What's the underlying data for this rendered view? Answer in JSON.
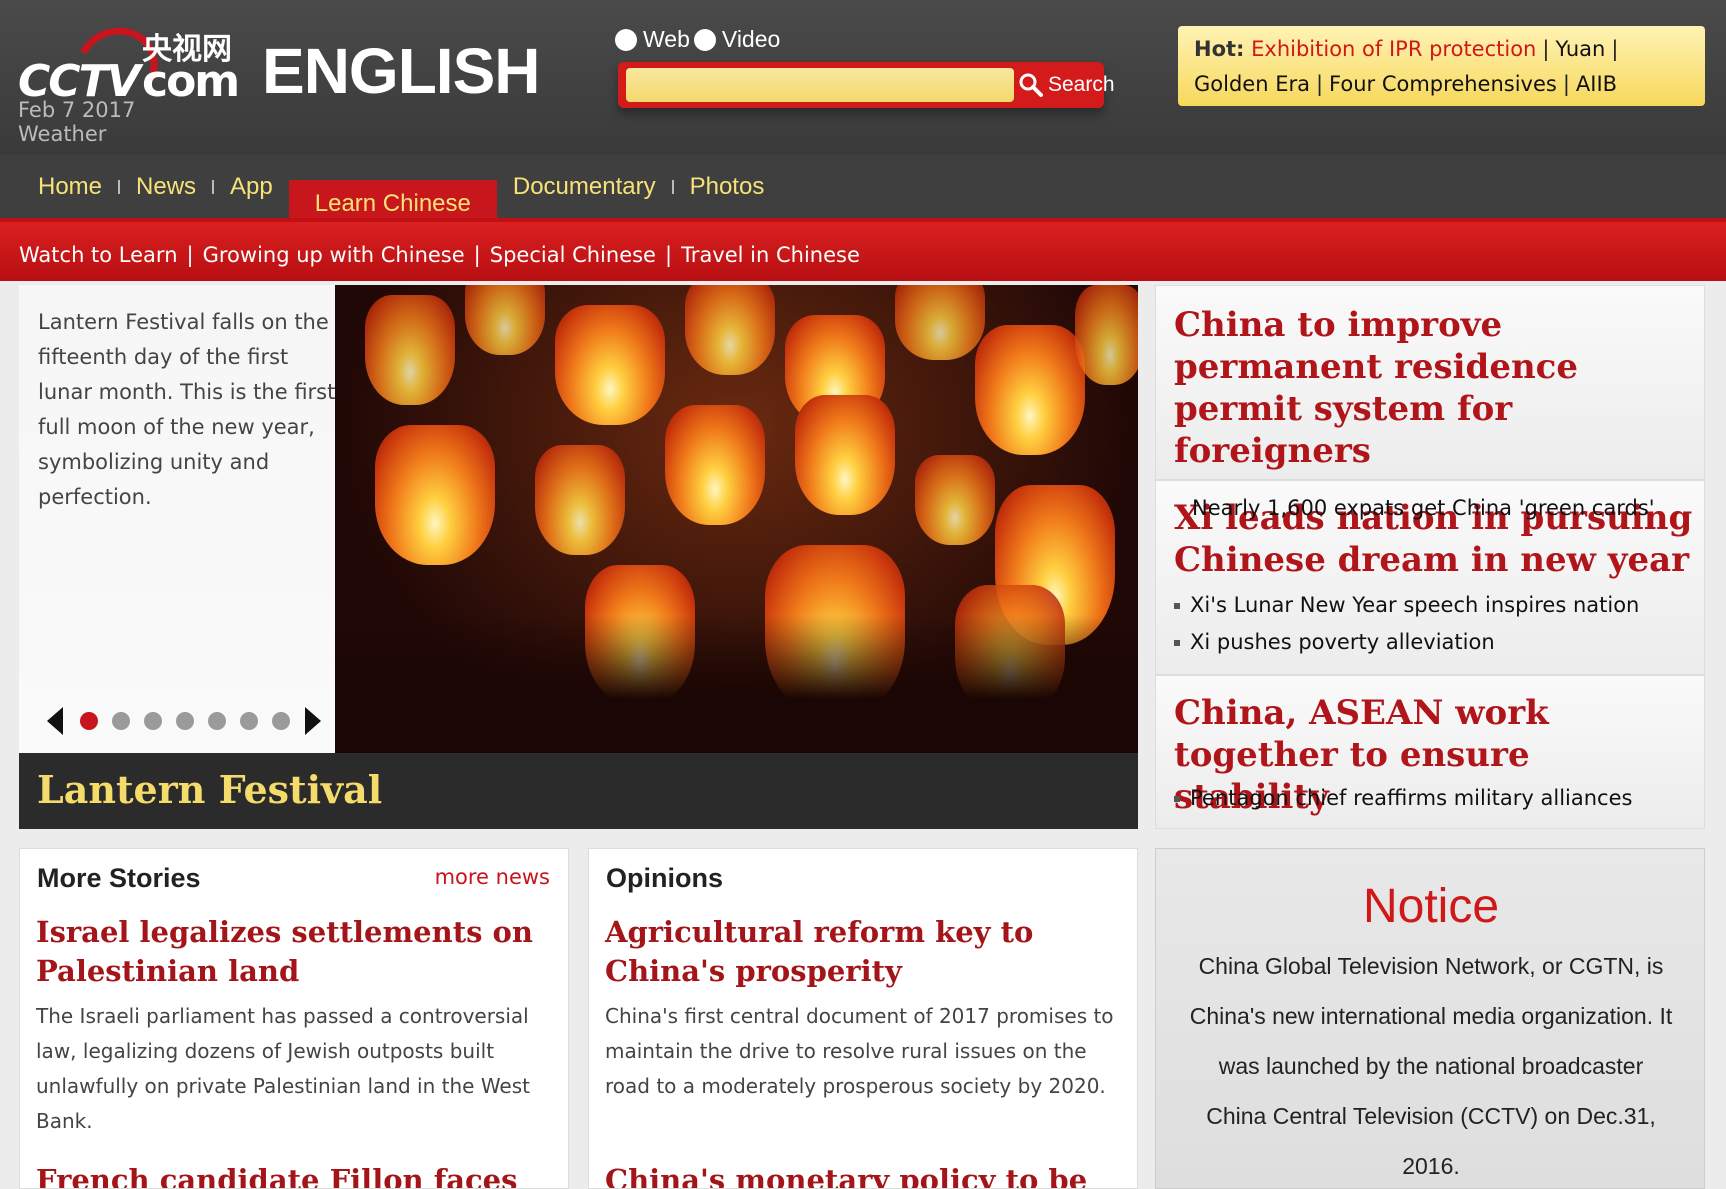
{
  "header": {
    "logo_cn": "央视网",
    "logo_cctv": "CCTV",
    "logo_com": "com",
    "site_name": "ENGLISH",
    "date": "Feb 7 2017",
    "weather": "Weather"
  },
  "search": {
    "options": [
      "Web",
      "Video"
    ],
    "button_label": "Search",
    "placeholder": ""
  },
  "hot": {
    "label": "Hot:",
    "items": [
      "Exhibition of IPR protection",
      "Yuan",
      "Golden Era",
      "Four Comprehensives",
      "AIIB"
    ]
  },
  "nav": {
    "items": [
      "Home",
      "News",
      "App",
      "Learn Chinese",
      "Documentary",
      "Photos"
    ],
    "active": "Learn Chinese"
  },
  "subnav": {
    "items": [
      "Watch to Learn",
      "Growing up with Chinese",
      "Special Chinese",
      "Travel in Chinese"
    ]
  },
  "hero": {
    "description": "Lantern Festival falls on the fifteenth day of the first lunar month. This is the first full moon of the new year, symbolizing unity and perfection.",
    "title": "Lantern Festival",
    "slide_count": 7,
    "active_slide": 1
  },
  "headlines": [
    {
      "title": "China to improve permanent residence permit system for foreigners",
      "sub": "Nearly 1,600 expats get China 'green cards'"
    },
    {
      "title": "Xi leads nation in pursuing Chinese dream in new year",
      "bullets": [
        "Xi's Lunar New Year speech inspires nation",
        "Xi pushes poverty alleviation"
      ]
    },
    {
      "title": "China, ASEAN work together to ensure stability",
      "bullets": [
        "Pentagon chief reaffirms military alliances"
      ]
    }
  ],
  "more_stories": {
    "title": "More Stories",
    "more_link": "more news",
    "stories": [
      {
        "title": "Israel legalizes settlements on Palestinian land",
        "desc": "The Israeli parliament has passed a controversial law, legalizing dozens of Jewish outposts built unlawfully on private Palestinian land in the West Bank."
      },
      {
        "title": "French candidate Fillon faces"
      }
    ]
  },
  "opinions": {
    "title": "Opinions",
    "stories": [
      {
        "title": "Agricultural reform key to China's prosperity",
        "desc": "China's first central document of 2017 promises to maintain the drive to resolve rural issues on the road to a moderately prosperous society by 2020."
      },
      {
        "title": "China's monetary policy to be"
      }
    ]
  },
  "notice": {
    "title": "Notice",
    "body": "China Global Television Network, or CGTN, is China's new international media organization. It was launched by the national broadcaster China Central Television (CCTV) on Dec.31, 2016."
  },
  "colors": {
    "brand_red": "#c8141c",
    "nav_yellow": "#f7e27a",
    "hero_title_yellow": "#f5dc6a",
    "headline_red": "#b0151a"
  }
}
